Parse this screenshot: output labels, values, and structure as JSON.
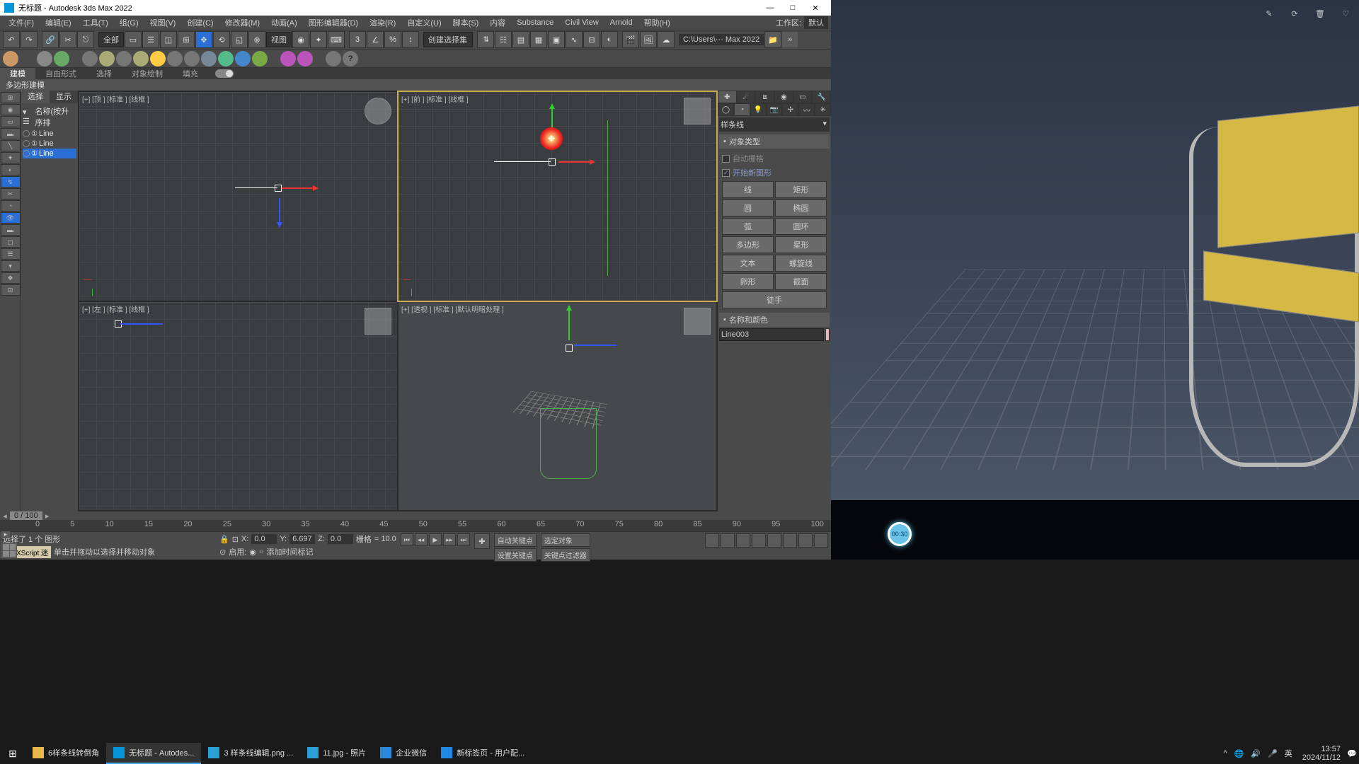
{
  "title": "无标题 - Autodesk 3ds Max 2022",
  "win": {
    "min": "—",
    "max": "□",
    "close": "✕"
  },
  "menu": [
    "文件(F)",
    "编辑(E)",
    "工具(T)",
    "组(G)",
    "视图(V)",
    "创建(C)",
    "修改器(M)",
    "动画(A)",
    "图形编辑器(D)",
    "渲染(R)",
    "自定义(U)",
    "脚本(S)",
    "内容",
    "Substance",
    "Civil View",
    "Arnold",
    "帮助(H)"
  ],
  "workspace_lbl": "工作区:",
  "workspace_val": "默认",
  "toolbar": {
    "all": "全部",
    "view": "视图",
    "selset": "创建选择集",
    "path": "C:\\Users\\··· Max 2022"
  },
  "ribbon": {
    "tabs": [
      "建模",
      "自由形式",
      "选择",
      "对象绘制",
      "填充"
    ],
    "sub": "多边形建模"
  },
  "leftTabs": {
    "sel": "选择",
    "disp": "显示"
  },
  "scene": {
    "header": "名称(按升序排",
    "items": [
      "Line",
      "Line",
      "Line"
    ]
  },
  "viewports": {
    "tl": "[+] [顶 ] [标准 ] [线框 ]",
    "tr": "[+] [前 ] [标准 ] [线框 ]",
    "bl": "[+] [左 ] [标准 ] [线框 ]",
    "br": "[+] [透视 ] [标准 ] [默认明暗处理 ]"
  },
  "cmd": {
    "dd": "样条线",
    "roll1": "对象类型",
    "chk1": "自动栅格",
    "chk2": "开始新图形",
    "btns": [
      "线",
      "矩形",
      "圆",
      "椭圆",
      "弧",
      "圆环",
      "多边形",
      "星形",
      "文本",
      "螺旋线",
      "卵形",
      "截面",
      "徒手"
    ],
    "roll2": "名称和颜色",
    "name": "Line003"
  },
  "time": {
    "frame": "0 / 100",
    "ticks": [
      "0",
      "5",
      "10",
      "15",
      "20",
      "25",
      "30",
      "35",
      "40",
      "45",
      "50",
      "55",
      "60",
      "65",
      "70",
      "75",
      "80",
      "85",
      "90",
      "95",
      "100"
    ]
  },
  "status": {
    "sel": "选择了 1 个 图形",
    "hint": "单击并拖动以选择并移动对象",
    "maxscript": "MAXScript 迷",
    "x_lbl": "X:",
    "x": "0.0",
    "y_lbl": "Y:",
    "y": "6.697",
    "z_lbl": "Z:",
    "z": "0.0",
    "grid_lbl": "栅格",
    "grid": "= 10.0",
    "enable": "启用:",
    "addmarker": "添加时间标记",
    "autokey": "自动关键点",
    "setkey": "设置关键点",
    "selobj": "选定对象",
    "keyfilter": "关键点过滤器"
  },
  "side": {
    "badge": "00:30"
  },
  "taskbar": {
    "items": [
      {
        "label": "6样条线转倒角",
        "color": "#e8b84a"
      },
      {
        "label": "无标题 - Autodes...",
        "color": "#0696d7"
      },
      {
        "label": "3 样条线编辑.png ...",
        "color": "#2a9fd6"
      },
      {
        "label": "11.jpg - 照片",
        "color": "#2a9fd6"
      },
      {
        "label": "企业微信",
        "color": "#2a88d6"
      },
      {
        "label": "新标签页 - 用户配...",
        "color": "#1e88e5"
      }
    ],
    "ime": "英",
    "time": "13:57",
    "date": "2024/11/12"
  }
}
